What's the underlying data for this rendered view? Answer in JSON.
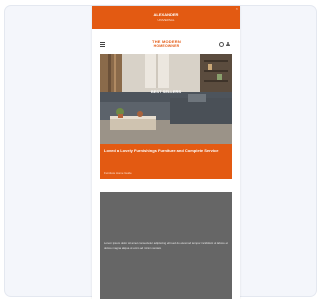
{
  "promo_bar": {
    "line1": "ALEXANDER",
    "line2": "UNIVERSAL",
    "close_glyph": "×",
    "color": "#e35a12"
  },
  "header": {
    "logo_line1": "THE MODERN",
    "logo_line2": "HOMEOWNER",
    "icons": [
      "menu-icon",
      "search-icon",
      "user-icon"
    ]
  },
  "hero": {
    "image": "living-room-with-grey-sectional-sofa",
    "caption": "BEST SELLERS"
  },
  "article": {
    "headline": "Loved a Lovely Furnishings Furniture and Complete Service",
    "byline": "Furniture Home Guide"
  },
  "ad": {
    "text": "Lorem ipsum dolor sit amet consectetur adipiscing elit sed do eiusmod tempor incididunt ut labore et dolore magna aliqua ut enim ad minim veniam"
  },
  "colors": {
    "accent": "#e35a12",
    "card_bg": "#f4f6fb",
    "ad_bg": "#666666"
  }
}
